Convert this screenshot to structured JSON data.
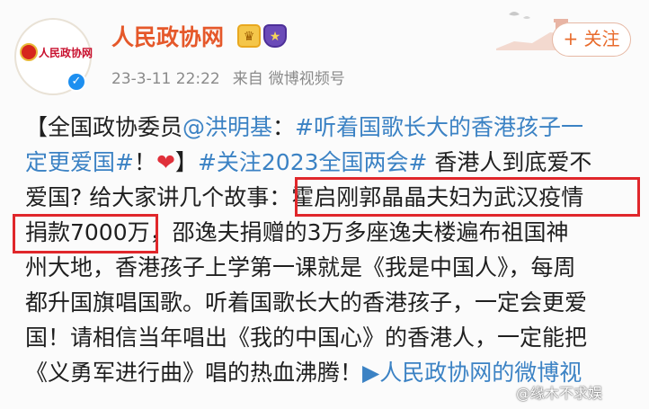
{
  "header": {
    "avatar_text": "人民政协网",
    "account_name": "人民政协网",
    "verified_icon": "verified-check-icon",
    "badges": [
      "crown-badge-icon",
      "shield-badge-icon"
    ],
    "timestamp": "23-3-11 22:22",
    "source_prefix": "来自",
    "source": "微博视频号",
    "follow_label": "+ 关注"
  },
  "post": {
    "l1_a": "【全国政协委员",
    "l1_mention": "@洪明基",
    "l1_b": "：",
    "l1_topic": "#听着国歌长大的香港孩子一",
    "l2_topic": "定更爱国#",
    "l2_a": "！",
    "l2_heart": "❤",
    "l2_b": "】",
    "l2_topic2": "#关注2023全国两会#",
    "l2_c": " 香港人到底爱不",
    "l3_a": "爱国? 给大家讲几个故事：",
    "l3_hl": "霍启刚郭晶晶夫妇为武汉疫情",
    "l4_hl": "捐款7000万",
    "l4_b": "，邵逸夫捐赠的3万多座逸夫楼遍布祖国神",
    "l5": "州大地，香港孩子上学第一课就是《我是中国人》，每周",
    "l6": "都升国旗唱国歌。听着国歌长大的香港孩子，一定会更爱",
    "l7": "国！请相信当年唱出《我的中国心》的香港人，一定能把",
    "l8_a": "《义勇军进行曲》唱的热血沸腾！",
    "l8_video_icon": "video-camera-icon",
    "l8_link": "人民政协网的微博视"
  },
  "watermark": "@缘木不求娱",
  "colors": {
    "name": "#e5582a",
    "link": "#3b82c4",
    "highlight_box": "#e0272b",
    "follow": "#e86b2c"
  }
}
